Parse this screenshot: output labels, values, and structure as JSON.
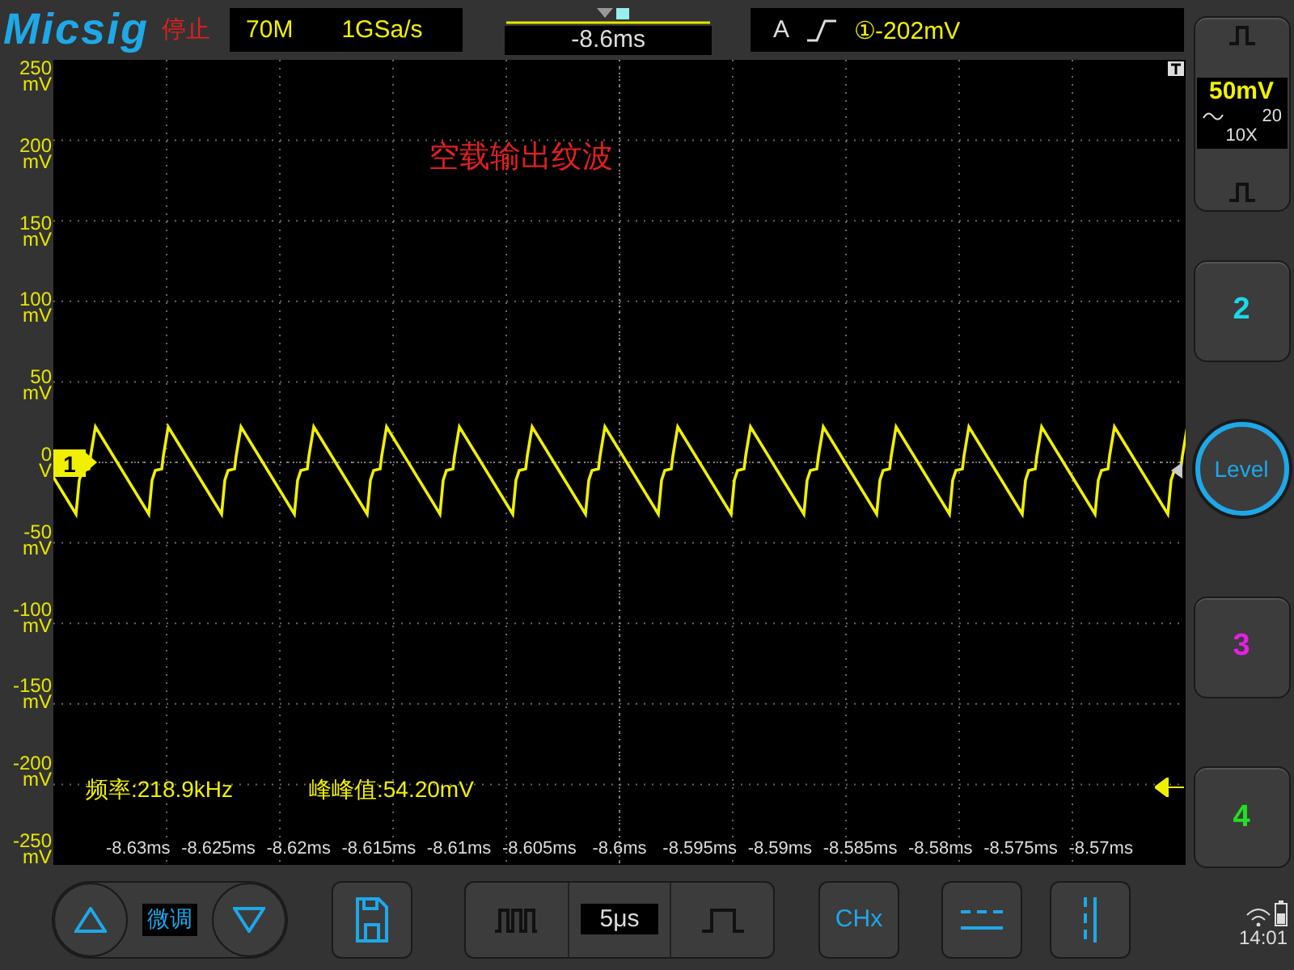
{
  "top_bar": {
    "logo": "Micsig",
    "run_state": "停止",
    "bandwidth": "70M",
    "sample_rate": "1GSa/s",
    "time_offset": "-8.6ms",
    "trigger_mode": "A",
    "trigger_level": "①-202mV"
  },
  "plot": {
    "annotation": "空载输出纹波",
    "channel_marker": "1",
    "y_labels": [
      {
        "value": "250",
        "unit": "mV"
      },
      {
        "value": "200",
        "unit": "mV"
      },
      {
        "value": "150",
        "unit": "mV"
      },
      {
        "value": "100",
        "unit": "mV"
      },
      {
        "value": "50",
        "unit": "mV"
      },
      {
        "value": "0",
        "unit": "V"
      },
      {
        "value": "-50",
        "unit": "mV"
      },
      {
        "value": "-100",
        "unit": "mV"
      },
      {
        "value": "-150",
        "unit": "mV"
      },
      {
        "value": "-200",
        "unit": "mV"
      },
      {
        "value": "-250",
        "unit": "mV"
      }
    ],
    "x_labels": [
      "-8.63ms",
      "-8.625ms",
      "-8.62ms",
      "-8.615ms",
      "-8.61ms",
      "-8.605ms",
      "-8.6ms",
      "-8.595ms",
      "-8.59ms",
      "-8.585ms",
      "-8.58ms",
      "-8.575ms",
      "-8.57ms"
    ],
    "measurements": [
      "频率:218.9kHz",
      "峰峰值:54.20mV"
    ]
  },
  "right_panel": [
    {
      "kind": "channel1",
      "scale": "50mV",
      "bandwidth_limit": "20",
      "probe": "10X"
    },
    {
      "kind": "channel",
      "label": "2",
      "color": "#19d8e8"
    },
    {
      "kind": "level",
      "label": "Level"
    },
    {
      "kind": "channel",
      "label": "3",
      "color": "#e81ee8"
    },
    {
      "kind": "channel",
      "label": "4",
      "color": "#22e022"
    }
  ],
  "bottom_bar": {
    "fine_tune": "微调",
    "timebase": "5μs",
    "channel_select": "CHx",
    "clock": "14:01"
  }
}
